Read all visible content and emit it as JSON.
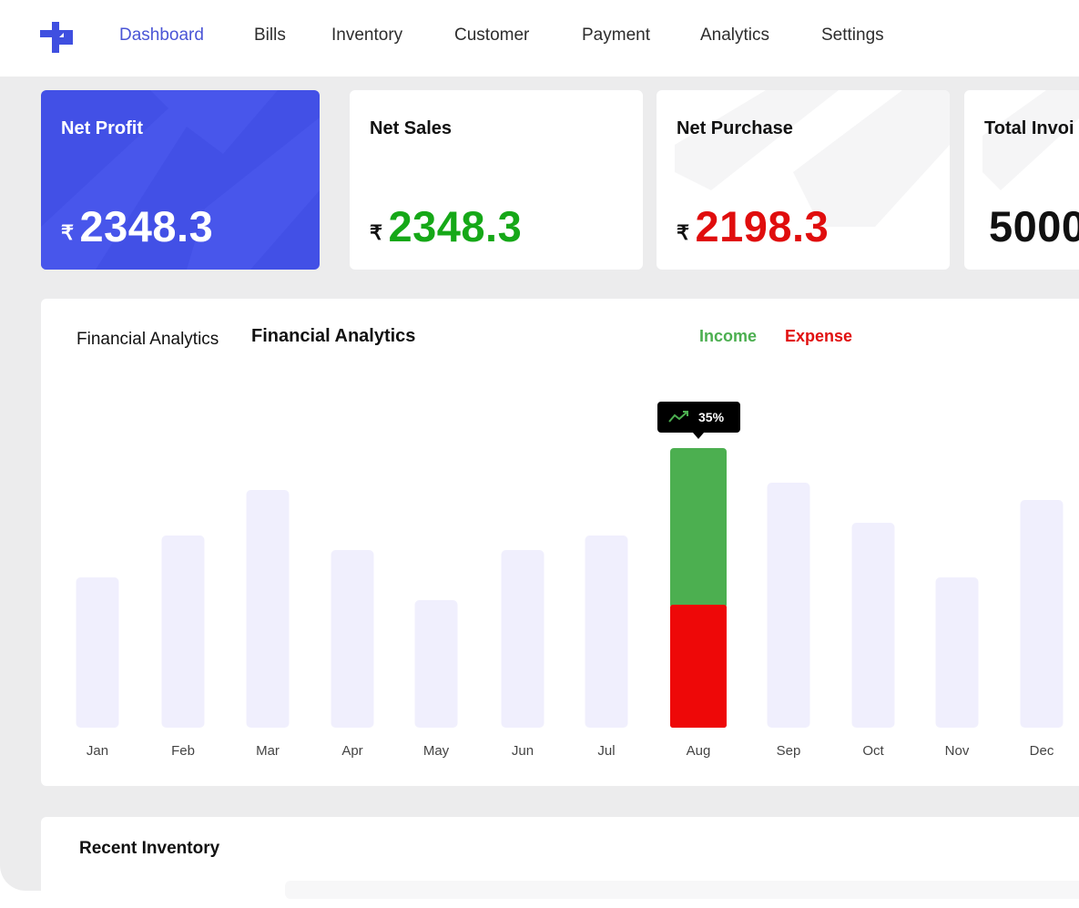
{
  "nav": {
    "items": [
      {
        "label": "Dashboard",
        "active": true
      },
      {
        "label": "Bills"
      },
      {
        "label": "Inventory"
      },
      {
        "label": "Customer"
      },
      {
        "label": "Payment"
      },
      {
        "label": "Analytics"
      },
      {
        "label": "Settings"
      }
    ],
    "logo_icon": "plus-cross-logo-icon"
  },
  "stats": [
    {
      "title": "Net Profit",
      "currency": "₹",
      "value": "2348.3",
      "color": "#ffffff"
    },
    {
      "title": "Net Sales",
      "currency": "₹",
      "value": "2348.3",
      "color": "#16a818"
    },
    {
      "title": "Net Purchase",
      "currency": "₹",
      "value": "2198.3",
      "color": "#e00d0d"
    },
    {
      "title": "Total Invoi",
      "value": "5000",
      "color": "#111111"
    }
  ],
  "analytics": {
    "label": "Financial Analytics",
    "title": "Financial Analytics",
    "legend": {
      "income": "Income",
      "expense": "Expense"
    }
  },
  "chart_data": {
    "type": "bar",
    "categories": [
      "Jan",
      "Feb",
      "Mar",
      "Apr",
      "May",
      "Jun",
      "Jul",
      "Aug",
      "Sep",
      "Oct",
      "Nov",
      "Dec"
    ],
    "values": [
      165,
      211,
      261,
      195,
      140,
      195,
      211,
      307,
      269,
      225,
      165,
      250
    ],
    "highlight": {
      "category": "Aug",
      "income": 172,
      "expense": 135,
      "change_label": "35%",
      "change_icon": "trend-up-icon"
    },
    "colors": {
      "bar": "#f0effd",
      "income": "#4caf50",
      "expense": "#ee0808",
      "tooltip": "#000000"
    },
    "ylim": [
      0,
      330
    ]
  },
  "inventory": {
    "title": "Recent Inventory"
  }
}
